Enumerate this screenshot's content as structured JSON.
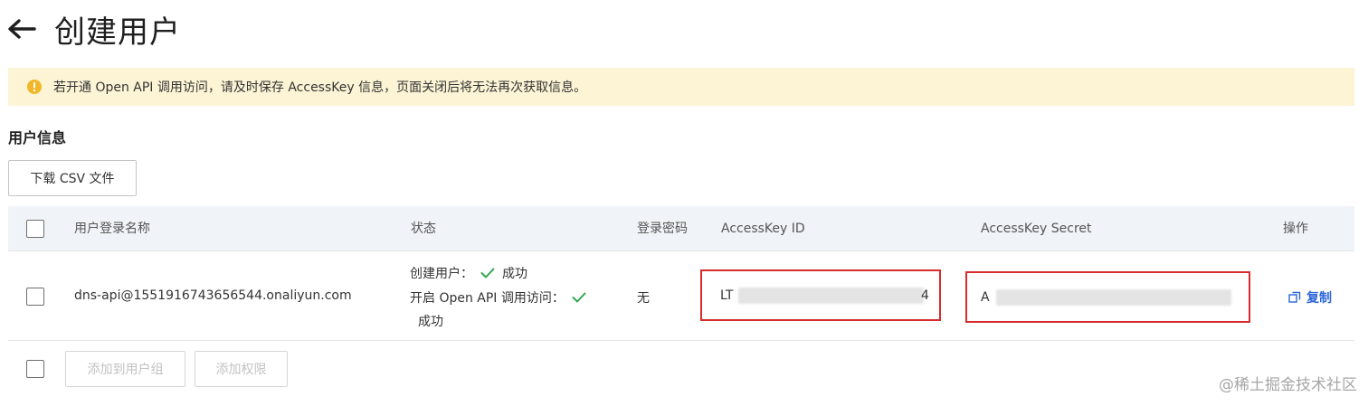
{
  "header": {
    "title": "创建用户"
  },
  "alert": {
    "text": "若开通 Open API 调用访问，请及时保存 AccessKey 信息，页面关闭后将无法再次获取信息。"
  },
  "section": {
    "title": "用户信息"
  },
  "toolbar": {
    "download_label": "下载 CSV 文件"
  },
  "table": {
    "columns": {
      "login_name": "用户登录名称",
      "status": "状态",
      "password": "登录密码",
      "ak_id": "AccessKey ID",
      "ak_secret": "AccessKey Secret",
      "actions": "操作"
    },
    "row": {
      "login_name": "dns-api@1551916743656544.onaliyun.com",
      "status_create_label": "创建用户：",
      "status_create_value": "成功",
      "status_api_label": "开启 Open API 调用访问：",
      "status_api_value": "成功",
      "password": "无",
      "ak_id_start": "LT",
      "ak_id_end": "4",
      "ak_secret_start": "A",
      "copy_label": "复制"
    }
  },
  "footer": {
    "add_to_group_label": "添加到用户组",
    "add_permission_label": "添加权限"
  },
  "watermark": "@稀土掘金技术社区",
  "colors": {
    "alert_bg": "#fcf4d5",
    "highlight_border": "#d62c2c",
    "link": "#2b66d9",
    "success": "#2fa84f"
  }
}
